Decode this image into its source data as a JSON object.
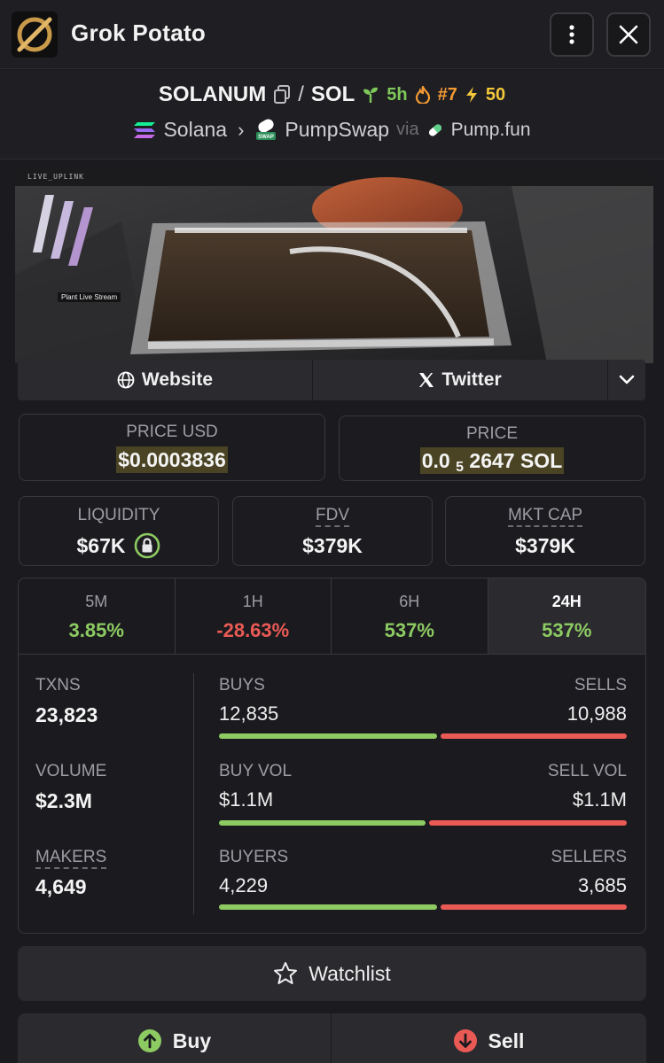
{
  "header": {
    "title": "Grok Potato",
    "more_icon": "vertical-dots-icon",
    "close_icon": "x-close-icon"
  },
  "pair": {
    "base": "SOLANUM",
    "slash": "/",
    "quote": "SOL",
    "age": "5h",
    "rank": "#7",
    "boosts": "50",
    "chain": "Solana",
    "dex": "PumpSwap",
    "via": "via",
    "launchpad": "Pump.fun"
  },
  "banner": {
    "tag": "LIVE_UPLINK",
    "caption": "Plant Live Stream"
  },
  "links": {
    "website": "Website",
    "twitter": "Twitter"
  },
  "price": {
    "usd_label": "PRICE USD",
    "usd_value": "$0.0003836",
    "native_label": "PRICE",
    "native_prefix": "0.0",
    "native_zeros": "5",
    "native_digits": "2647 SOL"
  },
  "metrics": {
    "liquidity_label": "LIQUIDITY",
    "liquidity_value": "$67K",
    "fdv_label": "FDV",
    "fdv_value": "$379K",
    "mcap_label": "MKT CAP",
    "mcap_value": "$379K"
  },
  "timeframes": [
    {
      "label": "5M",
      "change": "3.85%"
    },
    {
      "label": "1H",
      "change": "-28.63%"
    },
    {
      "label": "6H",
      "change": "537%"
    },
    {
      "label": "24H",
      "change": "537%"
    }
  ],
  "stats": {
    "txns_label": "TXNS",
    "txns_value": "23,823",
    "volume_label": "VOLUME",
    "volume_value": "$2.3M",
    "makers_label": "MAKERS",
    "makers_value": "4,649",
    "buys_label": "BUYS",
    "buys_value": "12,835",
    "sells_label": "SELLS",
    "sells_value": "10,988",
    "buyvol_label": "BUY VOL",
    "buyvol_value": "$1.1M",
    "sellvol_label": "SELL VOL",
    "sellvol_value": "$1.1M",
    "buyers_label": "BUYERS",
    "buyers_value": "4,229",
    "sellers_label": "SELLERS",
    "sellers_value": "3,685"
  },
  "ratios": {
    "buys_share": 0.54,
    "buyvol_share": 0.51,
    "buyers_share": 0.54
  },
  "actions": {
    "watchlist": "Watchlist",
    "buy": "Buy",
    "sell": "Sell"
  },
  "colors": {
    "positive": "#8dcb62",
    "negative": "#ea5a55",
    "highlight": "#4a4424"
  }
}
